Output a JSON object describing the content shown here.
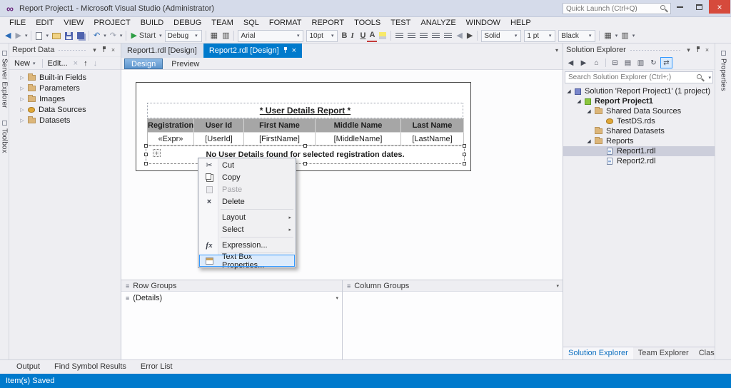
{
  "icons": {
    "logo": "∞",
    "dropdown": "▾",
    "submenu": "▸",
    "collapsed": "▷",
    "expanded": "◢",
    "back": "◀",
    "forward": "▶",
    "undo": "↶",
    "redo": "↷",
    "start": "▶",
    "home": "⌂",
    "refresh": "↻",
    "collapse_all": "⊟",
    "show_all": "▤",
    "properties": "▥",
    "sync": "⇄",
    "up": "↑",
    "down": "↓",
    "close": "×",
    "cut": "✂",
    "delete": "×",
    "menu_lines": "≡",
    "grid": "▦",
    "grid_alt": "▥",
    "move": "+"
  },
  "colors": {
    "accent": "#007acc",
    "selection_inactive": "#cccedb",
    "menu_highlight_border": "#3399ff"
  },
  "titlebar": {
    "title": "Report Project1 - Microsoft Visual Studio (Administrator)",
    "quick_launch": "Quick Launch (Ctrl+Q)"
  },
  "menu": [
    "FILE",
    "EDIT",
    "VIEW",
    "PROJECT",
    "BUILD",
    "DEBUG",
    "TEAM",
    "SQL",
    "FORMAT",
    "REPORT",
    "TOOLS",
    "TEST",
    "ANALYZE",
    "WINDOW",
    "HELP"
  ],
  "toolbar": {
    "start": "Start",
    "debug": "Debug",
    "font": "Arial",
    "font_size": "10pt",
    "bold": "B",
    "italic": "I",
    "underline": "U",
    "font_color": "A",
    "border_style": "Solid",
    "border_width": "1 pt",
    "border_color": "Black"
  },
  "left_tabs": [
    "Server Explorer",
    "Toolbox"
  ],
  "right_tabs": [
    "Properties"
  ],
  "report_data": {
    "title": "Report Data",
    "new_label": "New",
    "edit_label": "Edit...",
    "items": [
      "Built-in Fields",
      "Parameters",
      "Images",
      "Data Sources",
      "Datasets"
    ]
  },
  "doc_tabs": [
    "Report1.rdl [Design]",
    "Report2.rdl [Design]"
  ],
  "view_tabs": [
    "Design",
    "Preview"
  ],
  "report": {
    "title": "* User Details Report *",
    "columns": [
      "Registration",
      "User Id",
      "First Name",
      "Middle Name",
      "Last Name"
    ],
    "values": [
      "«Expr»",
      "[UserId]",
      "[FirstName]",
      "[MiddleName]",
      "[LastName]"
    ],
    "no_data": "No User Details found for selected registration dates."
  },
  "context_menu": {
    "cut": "Cut",
    "copy": "Copy",
    "paste": "Paste",
    "delete": "Delete",
    "layout": "Layout",
    "select": "Select",
    "expression": "Expression...",
    "textbox_properties": "Text Box Properties...",
    "fx_label": "fx"
  },
  "groups": {
    "row_title": "Row Groups",
    "column_title": "Column Groups",
    "details_label": "(Details)"
  },
  "solution_explorer": {
    "title": "Solution Explorer",
    "search_placeholder": "Search Solution Explorer (Ctrl+;)",
    "items": [
      "Solution 'Report Project1' (1 project)",
      "Report Project1",
      "Shared Data Sources",
      "TestDS.rds",
      "Shared Datasets",
      "Reports",
      "Report1.rdl",
      "Report2.rdl"
    ],
    "tabs": [
      "Solution Explorer",
      "Team Explorer",
      "Class View"
    ]
  },
  "bottom_tabs": [
    "Output",
    "Find Symbol Results",
    "Error List"
  ],
  "status": {
    "message": "Item(s) Saved"
  }
}
